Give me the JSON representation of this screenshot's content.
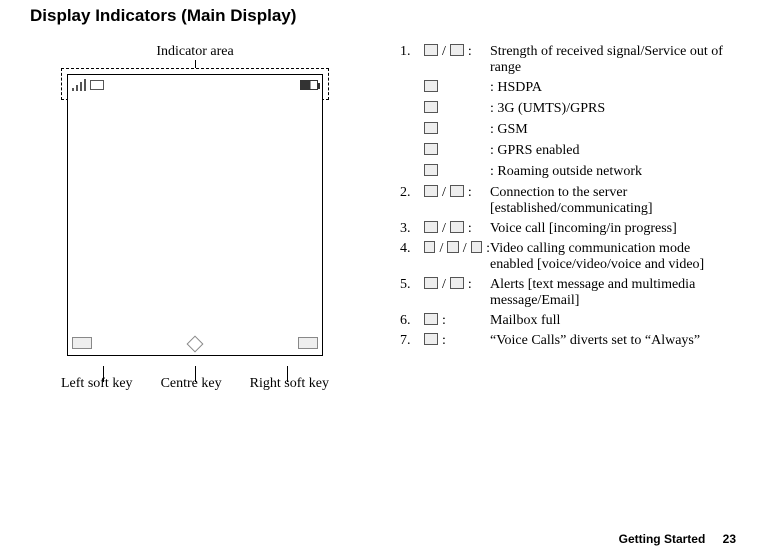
{
  "heading": "Display Indicators (Main Display)",
  "diagram": {
    "indicator_area_label": "Indicator area",
    "left_soft_key_label": "Left soft key",
    "centre_key_label": "Centre key",
    "right_soft_key_label": "Right soft key"
  },
  "entries": [
    {
      "num": "1.",
      "icons": [
        "signal",
        "/",
        "no-signal"
      ],
      "colon": ":",
      "desc": "Strength of received signal/Service out of range",
      "subs": [
        {
          "icon": "3G+",
          "desc": ": HSDPA"
        },
        {
          "icon": "3G",
          "desc": ": 3G (UMTS)/GPRS"
        },
        {
          "icon": "GSM",
          "desc": ": GSM"
        },
        {
          "icon": "G",
          "desc": ": GPRS enabled"
        },
        {
          "icon": "R",
          "desc": ": Roaming outside network"
        }
      ]
    },
    {
      "num": "2.",
      "icons": [
        "srv1",
        "/",
        "srv2"
      ],
      "colon": ":",
      "desc": "Connection to the server [established/communicating]"
    },
    {
      "num": "3.",
      "icons": [
        "call-in",
        "/",
        "call-prog"
      ],
      "colon": ":",
      "desc": "Voice call [incoming/in progress]"
    },
    {
      "num": "4.",
      "icons": [
        "vc1",
        "/",
        "vc2",
        "/",
        "vc3"
      ],
      "colon": ":",
      "desc": "Video calling communication mode enabled [voice/video/voice and video]"
    },
    {
      "num": "5.",
      "icons": [
        "msg1",
        "/",
        "msg2"
      ],
      "colon": ":",
      "desc": "Alerts [text message and multimedia message/Email]"
    },
    {
      "num": "6.",
      "icons": [
        "mailbox"
      ],
      "colon": ":",
      "desc": "Mailbox full"
    },
    {
      "num": "7.",
      "icons": [
        "divert"
      ],
      "colon": ":",
      "desc": "“Voice Calls” diverts set to “Always”"
    }
  ],
  "footer": {
    "section": "Getting Started",
    "page": "23"
  }
}
